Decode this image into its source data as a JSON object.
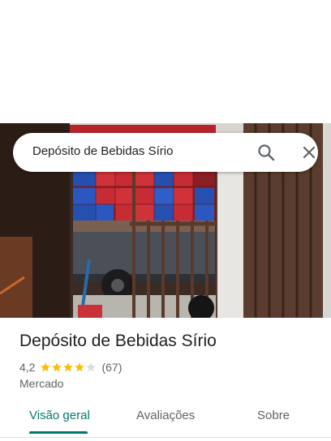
{
  "search": {
    "query": "Depósito de Bebidas Sírio",
    "search_icon": "search-icon",
    "close_icon": "close-icon"
  },
  "place": {
    "name": "Depósito de Bebidas Sírio",
    "rating": "4,2",
    "rating_stars": 4.2,
    "reviews": "(67)",
    "category": "Mercado"
  },
  "tabs": [
    {
      "label": "Visão geral",
      "active": true
    },
    {
      "label": "Avaliações",
      "active": false
    },
    {
      "label": "Sobre",
      "active": false
    }
  ],
  "colors": {
    "accent": "#00796b",
    "star": "#fbbc04",
    "star_empty": "#dadce0",
    "text_secondary": "#5f6368"
  }
}
